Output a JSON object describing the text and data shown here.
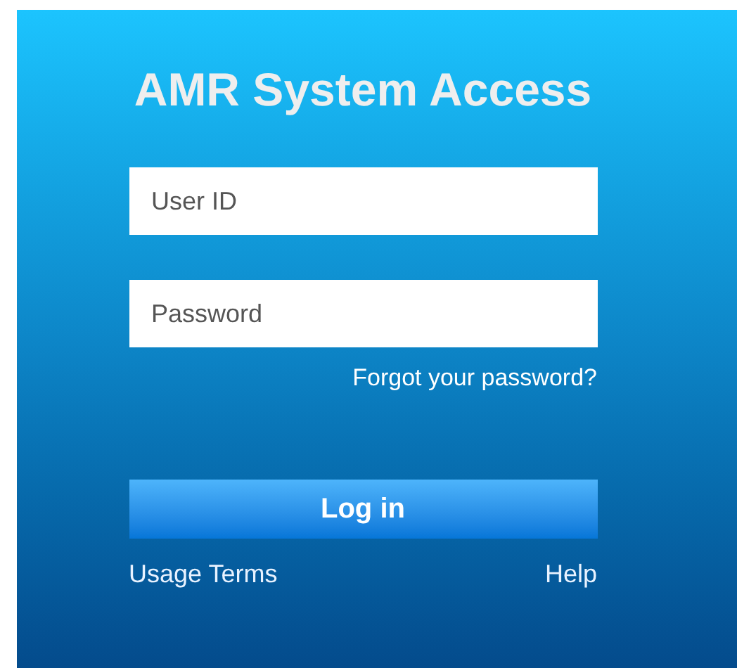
{
  "title": "AMR System Access",
  "fields": [
    {
      "placeholder": "User ID"
    },
    {
      "placeholder": "Password"
    }
  ],
  "forgot_link": "Forgot your password?",
  "login_button": "Log in",
  "footer_links": [
    "Usage Terms",
    "Help"
  ]
}
